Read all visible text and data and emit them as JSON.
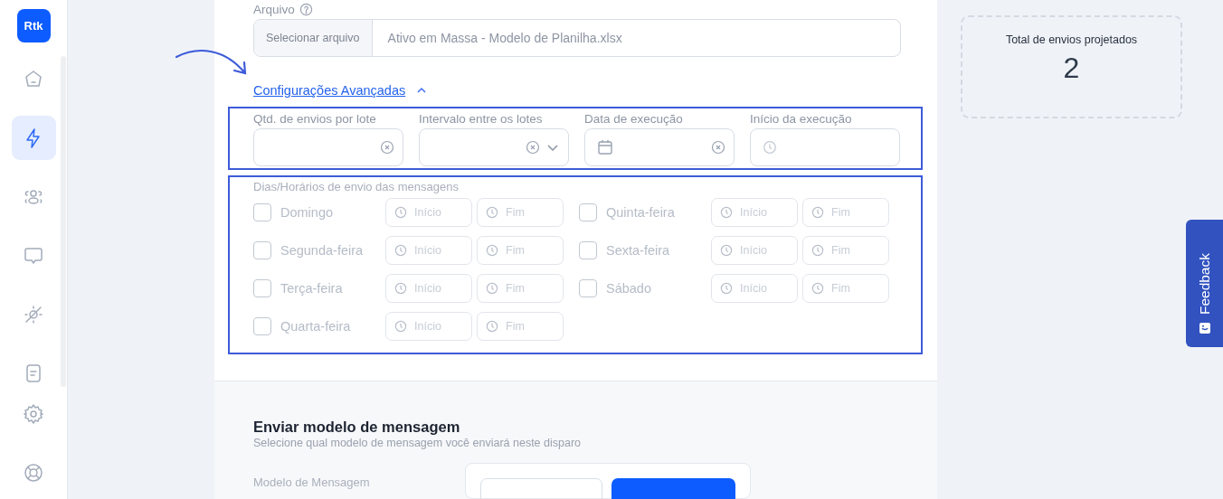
{
  "sidebar": {
    "logo": "Rtk",
    "items": [
      {
        "selected": false
      },
      {
        "selected": true
      },
      {
        "selected": false
      },
      {
        "selected": false
      },
      {
        "selected": false
      },
      {
        "selected": false
      },
      {
        "selected": false
      },
      {
        "selected": false
      }
    ]
  },
  "file": {
    "label": "Arquivo",
    "button": "Selecionar arquivo",
    "value": "Ativo em Massa - Modelo de Planilha.xlsx"
  },
  "advanced": {
    "label": "Configurações Avançadas",
    "expanded": true
  },
  "fields": [
    {
      "label": "Qtd. de envios por lote",
      "kind": "number"
    },
    {
      "label": "Intervalo entre os lotes",
      "kind": "select"
    },
    {
      "label": "Data de execução",
      "kind": "date"
    },
    {
      "label": "Início da execução",
      "kind": "time"
    }
  ],
  "schedule": {
    "label": "Dias/Horários de envio das mensagens",
    "disabled": true,
    "days": [
      {
        "name": "Domingo",
        "checked": false,
        "start": {
          "placeholder": "Início"
        },
        "end": {
          "placeholder": "Fim"
        }
      },
      {
        "name": "Segunda-feira",
        "checked": false,
        "start": {
          "placeholder": "Início"
        },
        "end": {
          "placeholder": "Fim"
        }
      },
      {
        "name": "Terça-feira",
        "checked": false,
        "start": {
          "placeholder": "Início"
        },
        "end": {
          "placeholder": "Fim"
        }
      },
      {
        "name": "Quarta-feira",
        "checked": false,
        "start": {
          "placeholder": "Início"
        },
        "end": {
          "placeholder": "Fim"
        }
      },
      {
        "name": "Quinta-feira",
        "checked": false,
        "start": {
          "placeholder": "Início"
        },
        "end": {
          "placeholder": "Fim"
        }
      },
      {
        "name": "Sexta-feira",
        "checked": false,
        "start": {
          "placeholder": "Início"
        },
        "end": {
          "placeholder": "Fim"
        }
      },
      {
        "name": "Sábado",
        "checked": false,
        "start": {
          "placeholder": "Início"
        },
        "end": {
          "placeholder": "Fim"
        }
      }
    ]
  },
  "template": {
    "title": "Enviar modelo de mensagem",
    "subtitle": "Selecione qual modelo de mensagem você enviará neste disparo",
    "field_label": "Modelo de Mensagem"
  },
  "summary": {
    "label": "Total de envios projetados",
    "value": "2"
  },
  "feedback": "Feedback"
}
